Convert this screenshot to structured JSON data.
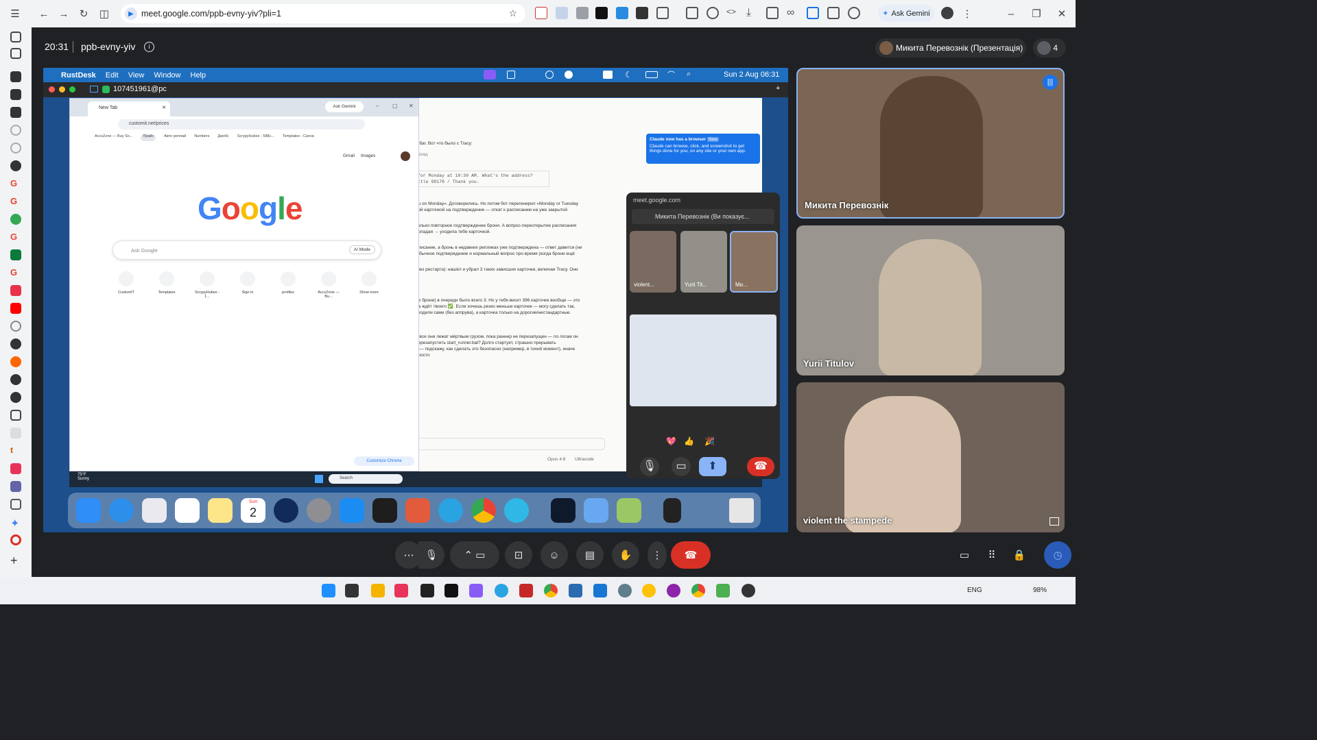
{
  "browser": {
    "url": "meet.google.com/ppb-evny-yiv?pli=1",
    "ask_gemini": "Ask Gemini"
  },
  "meet": {
    "time": "20:31",
    "meeting_code": "ppb-evny-yiv",
    "presenter_label": "Микита Перевознік (Презентація)",
    "participant_count": "4",
    "participants": [
      {
        "name": "Микита Перевознік"
      },
      {
        "name": "Yurii Titulov"
      },
      {
        "name": "violent the stampede"
      }
    ]
  },
  "share": {
    "mac_menu": {
      "app": "RustDesk",
      "items": [
        "Edit",
        "View",
        "Window",
        "Help"
      ],
      "clock": "Sun 2 Aug  06:31"
    },
    "rustdesk_tab": "107451961@pc",
    "remote_chrome": {
      "tab_title": "New Tab",
      "ask_gemini": "Ask Gemini",
      "url": "customit.net/prices",
      "bookmarks": [
        "AccsZone — Buy So...",
        "Прайс",
        "Авто реплай",
        "Numbers",
        "Джобс",
        "ScrypyHubex - 588c...",
        "Templates - Canva"
      ],
      "top_links": [
        "Gmail",
        "Images"
      ],
      "search_placeholder": "Ask Google",
      "ai_mode": "AI Mode",
      "shortcuts": [
        "CustomIT",
        "Templates",
        "ScrypyHubex - 1...",
        "Sign in",
        "profiles",
        "AccsZone — Bu...",
        "Show more"
      ],
      "customize": "Customize Chrome"
    },
    "claude_popup": {
      "title": "Claude now has a browser",
      "badge": "New",
      "text": "Claude can browse, click, and screenshot to get things done for you, on any site or your own app."
    },
    "chat_lines": [
      "й баг. Вот что было с Tracy:",
      "назад",
      "for Monday at 10:30 AM. What's the address?",
      "ttle 98178 / Thank you.",
      "ou on Monday». Договорились. Но потом бот перегенерил «Monday or Tuesday",
      "вой карточкой на подтверждение — откат к расписанию на уже закрытой",
      "только повторное подтверждение брони. А вопрос-переоткрытие расписания",
      "попадая → уходила тебе карточкой.",
      "описание, а бронь в недавних репликах уже подтверждена — ответ давится (ни",
      "Обычное подтверждение и нормальный вопрос про время (когда брони ещё",
      "(без рестарта): нашёл и убрал 3 таких зависших карточки, включая Tracy. Они",
      "ле брони) в очереди было всего 3. Но у тебя висит 396 карточек вообще — это",
      "на ждёт твоего ✅. Если хочешь резко меньше карточек — могу сделать так,",
      "уходили сами (без аппрува), а карточка только на дорогие/нестандартные.",
      "и все они лежат мёртвым грузом, пока раннер не перезапущен — по логам он",
      "перезапустить start_runner.bat? Долго стартует, страшно прерывать",
      "ь — подскажу, как сделать это безопасно (например, в тихий момент), иначе",
      "просто"
    ],
    "chat_footer": {
      "model": "Opus 4.8",
      "mode": "Ultracode"
    },
    "pip": {
      "url": "meet.google.com",
      "presenter": "Микита Перевознік (Ви показує...",
      "thumbs": [
        "violent...",
        "Yurii Tit...",
        "Ми..."
      ]
    },
    "win_taskbar": {
      "weather": "75°F",
      "weather_desc": "Sunny",
      "search": "Search"
    },
    "dock_calendar": {
      "month": "Sun",
      "day": "2"
    }
  },
  "taskbar": {
    "lang": "ENG",
    "battery": "98%"
  },
  "colors": {
    "end_call": "#d93025",
    "accent": "#8ab4f8",
    "meet_bg": "#202124"
  }
}
